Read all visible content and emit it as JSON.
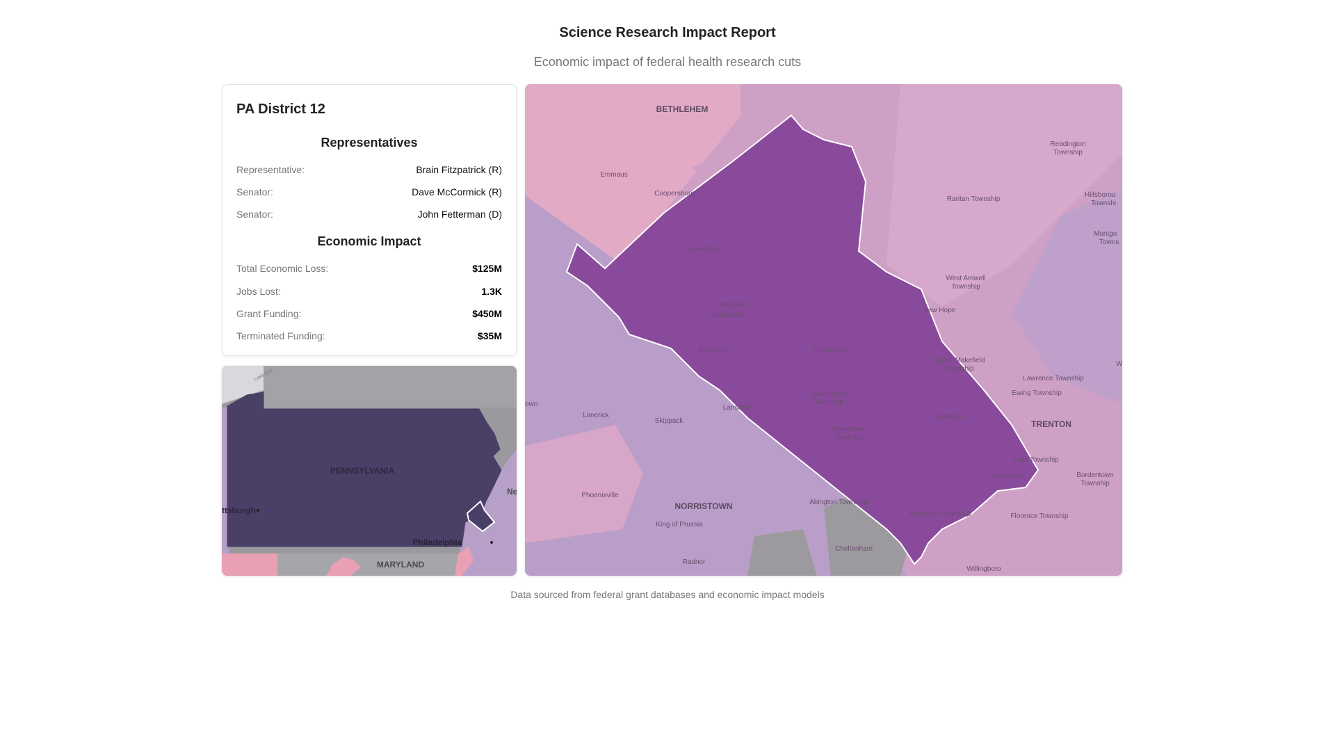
{
  "header": {
    "title": "Science Research Impact Report",
    "subtitle": "Economic impact of federal health research cuts"
  },
  "card": {
    "district": "PA District 12",
    "representatives_heading": "Representatives",
    "representatives": [
      {
        "label": "Representative:",
        "value": "Brain Fitzpatrick (R)"
      },
      {
        "label": "Senator:",
        "value": "Dave McCormick (R)"
      },
      {
        "label": "Senator:",
        "value": "John Fetterman (D)"
      }
    ],
    "economic_heading": "Economic Impact",
    "economic": [
      {
        "label": "Total Economic Loss:",
        "value": "$125M"
      },
      {
        "label": "Jobs Lost:",
        "value": "1.3K"
      },
      {
        "label": "Grant Funding:",
        "value": "$450M"
      },
      {
        "label": "Terminated Funding:",
        "value": "$35M"
      }
    ]
  },
  "mini_map": {
    "labels": {
      "state": "PENNSYLVANIA",
      "maryland": "MARYLAND",
      "philadelphia": "Philadelphia",
      "pittsburgh": "ttsburgh",
      "ne": "Ne",
      "lake": "Lake Erie"
    },
    "colors": {
      "state": "#4a3f66",
      "outside_gray": "#9a9a9e",
      "pink": "#e9a0b4",
      "lavender": "#b7a0c8"
    }
  },
  "main_map": {
    "labels": {
      "bethlehem": "BETHLEHEM",
      "emmaus": "Emmaus",
      "coopersburg": "Coopersburg",
      "quakertown": "Quakertown",
      "perkasie": "Perkasie",
      "sellersville": "Sellersville",
      "souderton": "Souderton",
      "doylestown": "Doylestown",
      "warrington": "Warrington",
      "warrington2": "Township",
      "warminster": "Warminster",
      "warminster2": "Township",
      "lansdale": "Lansdale",
      "limerick": "Limerick",
      "skippack": "Skippack",
      "phoenixville": "Phoenixville",
      "norristown": "NORRISTOWN",
      "kingofprussia": "King of Prussia",
      "radnor": "Radnor",
      "abington": "Abington Township",
      "cheltenham": "Cheltenham",
      "bensalem": "Bensalem Township",
      "newtown": "Newtown",
      "levittown": "Levittown",
      "fallstownship": "Falls Township",
      "trenton": "TRENTON",
      "ewing": "Ewing Township",
      "lawrence": "Lawrence Township",
      "newhope": "New Hope",
      "uppermakefield": "Upper Makefield",
      "uppermakefield2": "Township",
      "westamwell": "West Amwell",
      "westamwell2": "Township",
      "raritan": "Raritan Township",
      "readington": "Readington",
      "readington2": "Township",
      "hillsborough": "Hillsborou",
      "hillsborough2": "Townshi",
      "montgomery": "Montgo",
      "montgomery2": "Towns",
      "bordentown": "Bordentown",
      "bordentown2": "Township",
      "florence": "Florence Township",
      "willingboro": "Willingboro",
      "town_edge": "own",
      "w_edge": "W"
    },
    "colors": {
      "district": "#8a4a9b",
      "pink": "#e3aac5",
      "lavender": "#b89ec8",
      "nj": "#cfa0c6",
      "gray": "#9c9a9e"
    }
  },
  "footer": {
    "note": "Data sourced from federal grant databases and economic impact models"
  }
}
